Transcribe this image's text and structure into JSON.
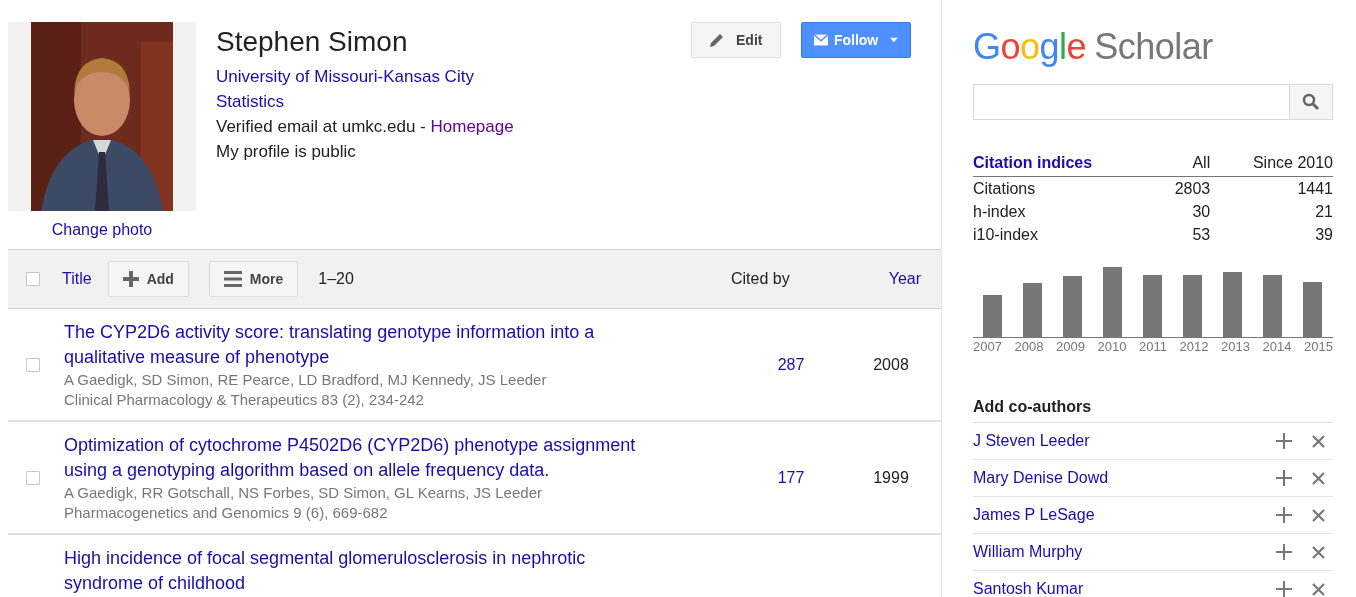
{
  "profile": {
    "name": "Stephen Simon",
    "affiliation": "University of Missouri-Kansas City",
    "field": "Statistics",
    "email_text": "Verified email at umkc.edu - ",
    "homepage": "Homepage",
    "visibility": "My profile is public",
    "change_photo": "Change photo"
  },
  "actions": {
    "edit": "Edit",
    "follow": "Follow"
  },
  "table": {
    "select_all_checked": false,
    "title_header": "Title",
    "add": "Add",
    "more": "More",
    "range": "1–20",
    "cited_header": "Cited by",
    "year_header": "Year",
    "rows": [
      {
        "title": "The CYP2D6 activity score: translating genotype information into a qualitative measure of phenotype",
        "authors": "A Gaedigk, SD Simon, RE Pearce, LD Bradford, MJ Kennedy, JS Leeder",
        "venue": "Clinical Pharmacology & Therapeutics 83 (2), 234-242",
        "cited": "287",
        "year": "2008",
        "checked": false
      },
      {
        "title": "Optimization of cytochrome P4502D6 (CYP2D6) phenotype assignment using a genotyping algorithm based on allele frequency data.",
        "authors": "A Gaedigk, RR Gotschall, NS Forbes, SD Simon, GL Kearns, JS Leeder",
        "venue": "Pharmacogenetics and Genomics 9 (6), 669-682",
        "cited": "177",
        "year": "1999",
        "checked": false
      },
      {
        "title": "High incidence of focal segmental glomerulosclerosis in nephrotic syndrome of childhood"
      }
    ]
  },
  "sidebar": {
    "logo_google": "Google",
    "logo_scholar": "Scholar",
    "indices": {
      "columns": [
        "Citation indices",
        "All",
        "Since 2010"
      ],
      "rows": [
        [
          "Citations",
          "2803",
          "1441"
        ],
        [
          "h-index",
          "30",
          "21"
        ],
        [
          "i10-index",
          "53",
          "39"
        ]
      ]
    },
    "chart_years": [
      "2007",
      "2008",
      "2009",
      "2010",
      "2011",
      "2012",
      "2013",
      "2014",
      "2015"
    ],
    "coauthors_title": "Add co-authors",
    "coauthors": [
      "J Steven Leeder",
      "Mary Denise Dowd",
      "James P LeSage",
      "William Murphy",
      "Santosh Kumar"
    ]
  }
}
